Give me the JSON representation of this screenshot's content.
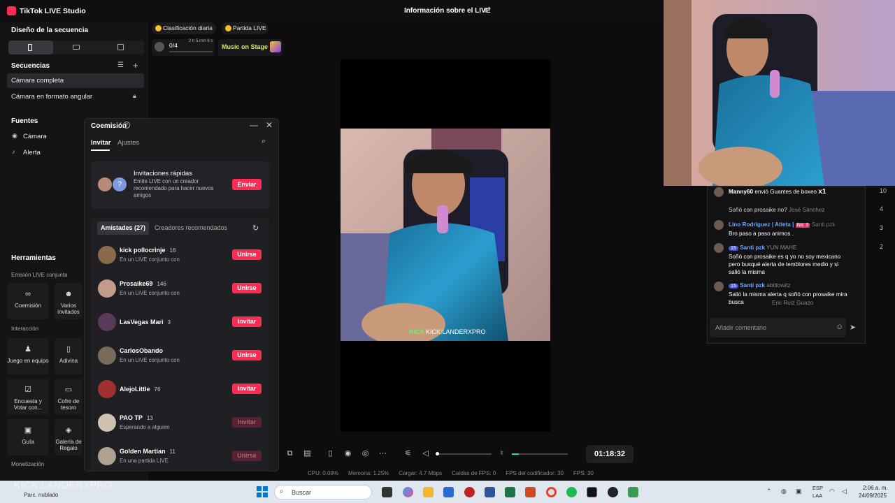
{
  "app": {
    "title": "TikTok LIVE Studio",
    "live_info": "Información sobre el LIVE"
  },
  "sidebar": {
    "layout_title": "Diseño de la secuencia",
    "sequences_title": "Secuencias",
    "sequences": [
      "Cámara completa",
      "Cámara en formato angular"
    ],
    "sources_title": "Fuentes",
    "sources": [
      "Cámara",
      "Alerta"
    ],
    "tools_title": "Herramientas",
    "cohost_section": "Emisión LIVE conjunta",
    "cohost_tools": [
      "Coemisión",
      "Varios invitados"
    ],
    "interaction_section": "Interacción",
    "interaction_tools": [
      "Juego en equipo",
      "Adivina",
      "Encuesta y Votar con...",
      "Cofre de tesoro",
      "Guía",
      "Galería de Regalo"
    ],
    "monetization_section": "Monetización"
  },
  "topbar": {
    "ranking": "Clasificación diaria",
    "match": "Partida LIVE",
    "battle_progress": "0/4",
    "battle_timer": "2 h 5 min 6 s",
    "music": "Music on Stage"
  },
  "preview": {
    "overlay_text": "KICK:LANDERXPRO",
    "kick_logo": "KICK"
  },
  "modal": {
    "title": "Coemisión",
    "tabs": [
      "Invitar",
      "Ajustes"
    ],
    "quick": {
      "title": "Invitaciones rápidas",
      "desc": "Emite LIVE con un creador recomendado para hacer nuevos amigos",
      "button": "Enviar"
    },
    "segments": [
      "Amistades (27)",
      "Creadores recomendados"
    ],
    "friends": [
      {
        "name": "kick pollocrinje",
        "count": "16",
        "status": "En un LIVE conjunto con",
        "button": "Unirse",
        "enabled": true,
        "color": "#8a6a4a"
      },
      {
        "name": "Prosaike69",
        "count": "146",
        "status": "En un LIVE conjunto con",
        "button": "Unirse",
        "enabled": true,
        "color": "#c49a8a"
      },
      {
        "name": "LasVegas Mari",
        "count": "3",
        "status": "",
        "button": "Invitar",
        "enabled": true,
        "color": "#5a3a5a"
      },
      {
        "name": "CarlosObando",
        "count": "",
        "status": "En un LIVE conjunto con",
        "button": "Unirse",
        "enabled": true,
        "color": "#7a6a5a"
      },
      {
        "name": "AlejoLittle",
        "count": "76",
        "status": "",
        "button": "Invitar",
        "enabled": true,
        "color": "#a03030"
      },
      {
        "name": "PAO TP",
        "count": "13",
        "status": "Esperando a alguien",
        "button": "Invitar",
        "enabled": false,
        "color": "#d0c0b0"
      },
      {
        "name": "Golden Martian",
        "count": "11",
        "status": "En una partida LIVE",
        "button": "Unirse",
        "enabled": false,
        "color": "#b0a090"
      }
    ]
  },
  "controls": {
    "timer": "01:18:32"
  },
  "stats": {
    "cpu": "CPU: 0.09%",
    "memory": "Memoria: 1.25%",
    "upload": "Cargar: 4.7 Mbps",
    "fps_drop": "Caídas de FPS: 0",
    "encoder_fps": "FPS del codificador: 30",
    "fps": "FPS: 30"
  },
  "chat": {
    "gift_user": "Manny60",
    "gift_text": "envió Guantes de boxeo",
    "gift_multiplier": "x1",
    "partial_line": "Soñó con prosaike no?",
    "partial_user": "José Sánchez",
    "msg1_user": "Lino Rodriguez | Atleta |",
    "msg1_badge": "No. 3",
    "msg1_text": "Bro paso a paso animos .",
    "msg1_sub": "Santi pzk",
    "msg2_level": "15",
    "msg2_user": "Santi pzk",
    "msg2_sub": "YUN MAHE",
    "msg2_text": "Soñó con prosaike es q yo no soy mexicano pero busqué alerta de temblores medio y si salió la misma",
    "msg3_level": "15",
    "msg3_user": "Santi pzk",
    "msg3_sub": "abittowitz",
    "msg3_text": "Salió la misma alerta q soñó con prosaike mira busca",
    "msg3_sub2": "Eric Ruiz Guazo",
    "input_placeholder": "Añadir comentario",
    "side_numbers": [
      "10",
      "4",
      "3",
      "2"
    ]
  },
  "taskbar": {
    "watermark": "KICK:LANDERXPRO",
    "weather": "Parc. nublado",
    "search": "Buscar",
    "lang1": "ESP",
    "lang2": "LAA",
    "time": "2:06 a. m.",
    "date": "24/09/2025"
  }
}
